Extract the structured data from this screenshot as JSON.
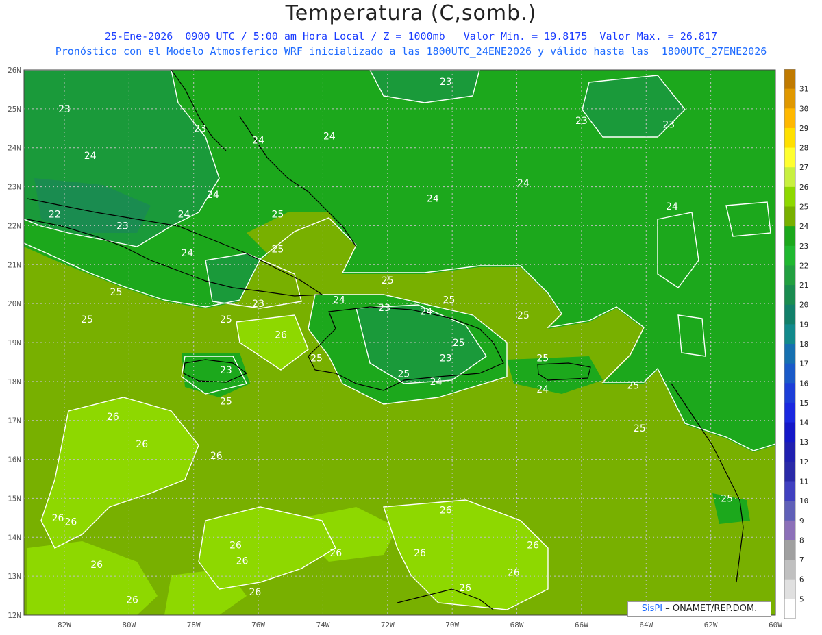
{
  "header": {
    "title": "Temperatura (C,somb.)",
    "line1": "25-Ene-2026  0900 UTC / 5:00 am Hora Local / Z = 1000mb   Valor Min. = 19.8175  Valor Max. = 26.817",
    "line2": "Pronóstico con el Modelo Atmosferico WRF inicializado a las 1800UTC_24ENE2026 y válido hasta las  1800UTC_27ENE2026"
  },
  "axes": {
    "lat_labels": [
      "26N",
      "25N",
      "24N",
      "23N",
      "22N",
      "21N",
      "20N",
      "19N",
      "18N",
      "17N",
      "16N",
      "15N",
      "14N",
      "13N",
      "12N"
    ],
    "lon_labels": [
      "82W",
      "80W",
      "78W",
      "76W",
      "74W",
      "72W",
      "70W",
      "68W",
      "66W",
      "64W",
      "62W",
      "60W"
    ]
  },
  "colorbar": {
    "levels": [
      "31",
      "30",
      "29",
      "28",
      "27",
      "26",
      "25",
      "24",
      "23",
      "22",
      "21",
      "20",
      "19",
      "18",
      "17",
      "16",
      "15",
      "14",
      "13",
      "12",
      "11",
      "10",
      "9",
      "8",
      "7",
      "6",
      "5"
    ],
    "colors": [
      "#c07a00",
      "#e09800",
      "#ffb800",
      "#ffe000",
      "#ffff30",
      "#c8f040",
      "#8ed800",
      "#78b000",
      "#1ca81c",
      "#20b830",
      "#22a040",
      "#1a8c50",
      "#12806a",
      "#128a8c",
      "#1670b0",
      "#1a5ac8",
      "#1c3ed8",
      "#1a28e0",
      "#1418c8",
      "#2020b0",
      "#2a2aa8",
      "#4040c0",
      "#6060b8",
      "#8c70b8",
      "#a0a0a0",
      "#c0c0c0",
      "#e0e0e0",
      "#ffffff"
    ]
  },
  "contour_labels": [
    {
      "text": "23",
      "lat": 25.0,
      "lon": -82.0
    },
    {
      "text": "24",
      "lat": 23.8,
      "lon": -81.2
    },
    {
      "text": "22",
      "lat": 22.3,
      "lon": -82.3
    },
    {
      "text": "23",
      "lat": 22.0,
      "lon": -80.2
    },
    {
      "text": "23",
      "lat": 24.5,
      "lon": -77.8
    },
    {
      "text": "24",
      "lat": 24.2,
      "lon": -76.0
    },
    {
      "text": "24",
      "lat": 24.3,
      "lon": -73.8
    },
    {
      "text": "24",
      "lat": 22.8,
      "lon": -77.4
    },
    {
      "text": "24",
      "lat": 22.3,
      "lon": -78.3
    },
    {
      "text": "24",
      "lat": 21.3,
      "lon": -78.2
    },
    {
      "text": "25",
      "lat": 22.3,
      "lon": -75.4
    },
    {
      "text": "25",
      "lat": 21.4,
      "lon": -75.4
    },
    {
      "text": "23",
      "lat": 20.0,
      "lon": -76.0
    },
    {
      "text": "24",
      "lat": 20.1,
      "lon": -73.5
    },
    {
      "text": "25",
      "lat": 20.3,
      "lon": -80.4
    },
    {
      "text": "25",
      "lat": 19.6,
      "lon": -81.3
    },
    {
      "text": "25",
      "lat": 19.6,
      "lon": -77.0
    },
    {
      "text": "26",
      "lat": 19.2,
      "lon": -75.3
    },
    {
      "text": "23",
      "lat": 19.9,
      "lon": -72.1
    },
    {
      "text": "24",
      "lat": 19.8,
      "lon": -70.8
    },
    {
      "text": "25",
      "lat": 20.6,
      "lon": -72.0
    },
    {
      "text": "25",
      "lat": 20.1,
      "lon": -70.1
    },
    {
      "text": "25",
      "lat": 19.0,
      "lon": -69.8
    },
    {
      "text": "23",
      "lat": 18.6,
      "lon": -70.2
    },
    {
      "text": "24",
      "lat": 18.0,
      "lon": -70.5
    },
    {
      "text": "25",
      "lat": 18.2,
      "lon": -71.5
    },
    {
      "text": "25",
      "lat": 18.6,
      "lon": -74.2
    },
    {
      "text": "23",
      "lat": 18.3,
      "lon": -77.0
    },
    {
      "text": "25",
      "lat": 17.5,
      "lon": -77.0
    },
    {
      "text": "25",
      "lat": 19.7,
      "lon": -67.8
    },
    {
      "text": "25",
      "lat": 18.6,
      "lon": -67.2
    },
    {
      "text": "24",
      "lat": 17.8,
      "lon": -67.2
    },
    {
      "text": "25",
      "lat": 17.9,
      "lon": -64.4
    },
    {
      "text": "25",
      "lat": 16.8,
      "lon": -64.2
    },
    {
      "text": "23",
      "lat": 25.7,
      "lon": -70.2
    },
    {
      "text": "23",
      "lat": 24.7,
      "lon": -66.0
    },
    {
      "text": "23",
      "lat": 24.6,
      "lon": -63.3
    },
    {
      "text": "24",
      "lat": 23.1,
      "lon": -67.8
    },
    {
      "text": "24",
      "lat": 22.7,
      "lon": -70.6
    },
    {
      "text": "24",
      "lat": 22.5,
      "lon": -63.2
    },
    {
      "text": "25",
      "lat": 15.0,
      "lon": -61.5
    },
    {
      "text": "26",
      "lat": 17.1,
      "lon": -80.5
    },
    {
      "text": "26",
      "lat": 16.4,
      "lon": -79.6
    },
    {
      "text": "26",
      "lat": 16.1,
      "lon": -77.3
    },
    {
      "text": "26",
      "lat": 14.5,
      "lon": -82.2
    },
    {
      "text": "26",
      "lat": 14.4,
      "lon": -81.8
    },
    {
      "text": "26",
      "lat": 13.3,
      "lon": -81.0
    },
    {
      "text": "26",
      "lat": 12.4,
      "lon": -79.9
    },
    {
      "text": "26",
      "lat": 13.8,
      "lon": -76.7
    },
    {
      "text": "26",
      "lat": 13.4,
      "lon": -76.5
    },
    {
      "text": "26",
      "lat": 13.6,
      "lon": -73.6
    },
    {
      "text": "26",
      "lat": 12.6,
      "lon": -76.1
    },
    {
      "text": "26",
      "lat": 14.7,
      "lon": -70.2
    },
    {
      "text": "26",
      "lat": 13.6,
      "lon": -71.0
    },
    {
      "text": "26",
      "lat": 13.1,
      "lon": -68.1
    },
    {
      "text": "26",
      "lat": 13.8,
      "lon": -67.5
    },
    {
      "text": "26",
      "lat": 12.7,
      "lon": -69.6
    }
  ],
  "credit": {
    "brand": "SisPI",
    "text": "– ONAMET/REP.DOM."
  }
}
